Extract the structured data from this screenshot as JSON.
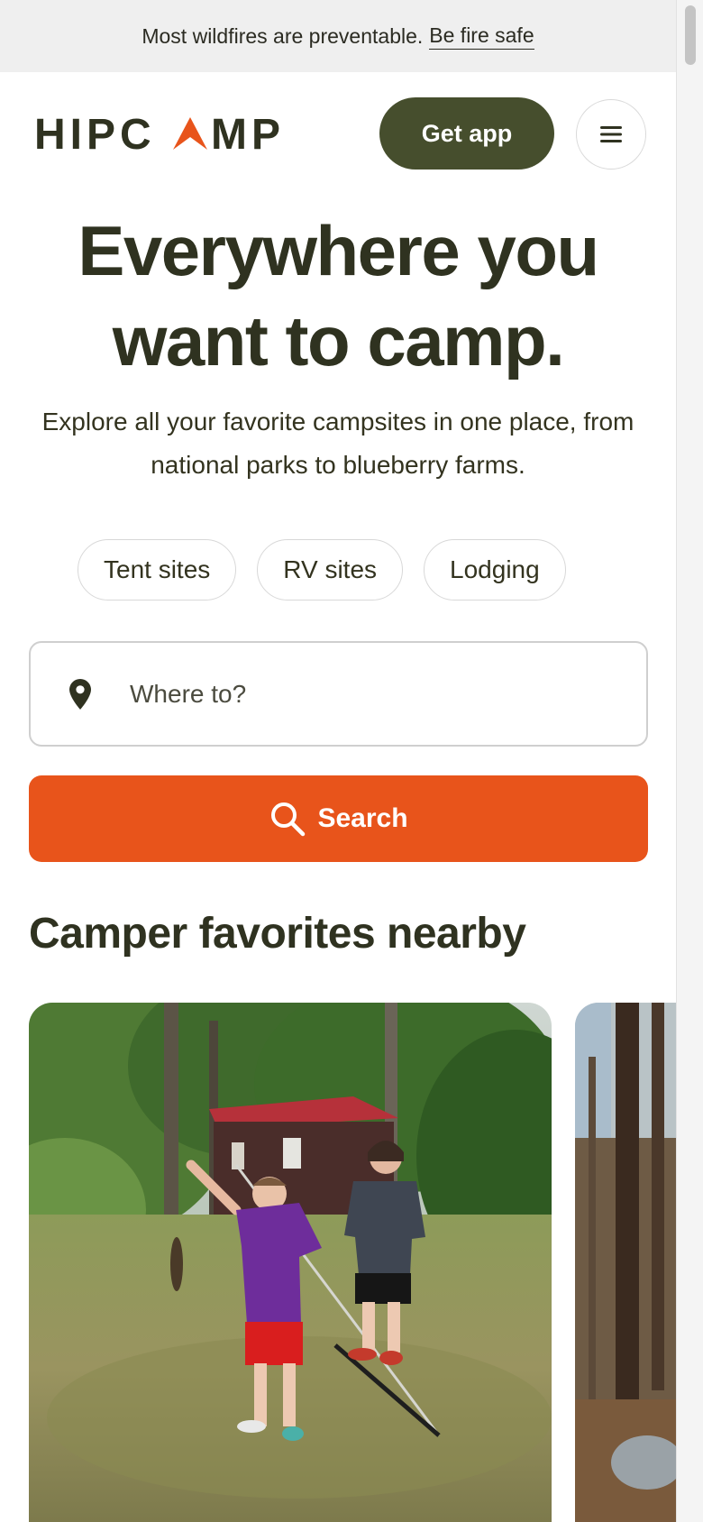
{
  "banner": {
    "text": "Most wildfires are preventable.",
    "link": "Be fire safe"
  },
  "header": {
    "logo_text": "HIPCAMP",
    "get_app_label": "Get app"
  },
  "hero": {
    "title": "Everywhere you want to camp.",
    "subtitle": "Explore all your favorite campsites in one place, from national parks to blueberry farms."
  },
  "filters": [
    {
      "label": "Tent sites"
    },
    {
      "label": "RV sites"
    },
    {
      "label": "Lodging"
    }
  ],
  "search": {
    "placeholder": "Where to?",
    "button_label": "Search"
  },
  "section": {
    "title": "Camper favorites nearby"
  },
  "colors": {
    "brand_green": "#464e2d",
    "accent_orange": "#e8541b",
    "text_dark": "#2f3220"
  }
}
